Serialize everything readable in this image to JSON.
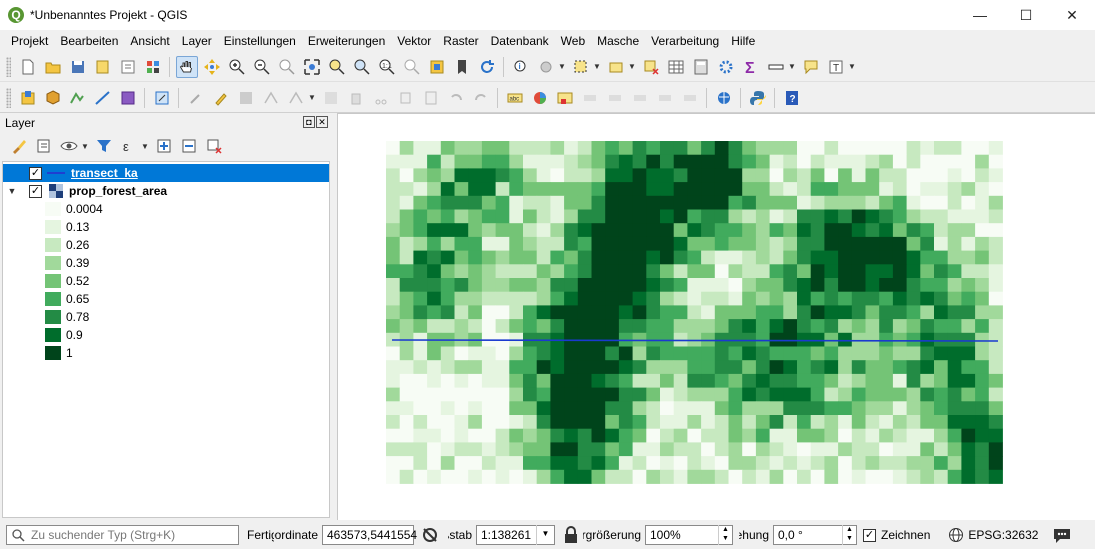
{
  "window": {
    "title": "*Unbenanntes Projekt - QGIS",
    "minimize": "—",
    "maximize": "☐",
    "close": "✕"
  },
  "menu": [
    "Projekt",
    "Bearbeiten",
    "Ansicht",
    "Layer",
    "Einstellungen",
    "Erweiterungen",
    "Vektor",
    "Raster",
    "Datenbank",
    "Web",
    "Masche",
    "Verarbeitung",
    "Hilfe"
  ],
  "layers_panel": {
    "title": "Layer",
    "layers": [
      {
        "name": "transect_ka",
        "checked": true,
        "selected": true,
        "color": "#1f3fd1"
      },
      {
        "name": "prop_forest_area",
        "checked": true,
        "selected": false,
        "expanded": true
      }
    ],
    "legend": [
      {
        "label": "0.0004",
        "color": "#f7fcf5"
      },
      {
        "label": "0.13",
        "color": "#e5f5e0"
      },
      {
        "label": "0.26",
        "color": "#c7e9c0"
      },
      {
        "label": "0.39",
        "color": "#a1d99b"
      },
      {
        "label": "0.52",
        "color": "#74c476"
      },
      {
        "label": "0.65",
        "color": "#41ab5d"
      },
      {
        "label": "0.78",
        "color": "#238b45"
      },
      {
        "label": "0.9",
        "color": "#006d2c"
      },
      {
        "label": "1",
        "color": "#00441b"
      }
    ]
  },
  "map": {
    "transect_color": "#1a3ad0"
  },
  "status": {
    "search_placeholder": "Zu suchender Typ (Strg+K)",
    "ready_label": "Fertig",
    "coord_label": "Koordinate",
    "coord_value": "463573,5441554",
    "scale_label": "Maßstab",
    "scale_value": "1:138261",
    "magnifier_label": "Vergrößerung",
    "magnifier_value": "100%",
    "rotation_label": "Drehung",
    "rotation_value": "0,0 °",
    "render_label": "Zeichnen",
    "render_checked": true,
    "crs": "EPSG:32632"
  }
}
